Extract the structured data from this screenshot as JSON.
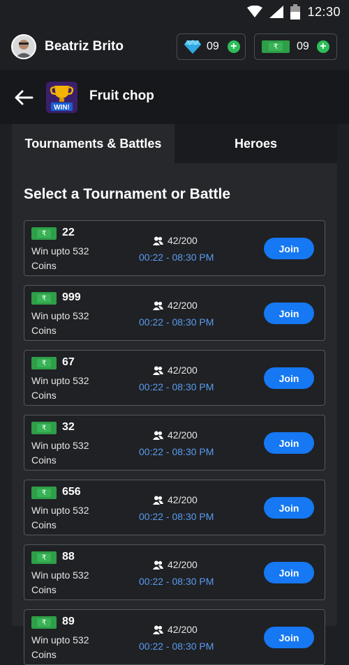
{
  "status_bar": {
    "time": "12:30"
  },
  "header": {
    "username": "Beatriz Brito",
    "gems": {
      "value": "09",
      "icon": "diamond-icon"
    },
    "cash": {
      "value": "09",
      "icon": "rupee-note-icon"
    }
  },
  "game": {
    "title": "Fruit chop",
    "icon_text": "WIN!"
  },
  "tabs": [
    {
      "label": "Tournaments & Battles",
      "active": true
    },
    {
      "label": "Heroes",
      "active": false
    }
  ],
  "section_title": "Select a Tournament or Battle",
  "currency_symbol": "₹",
  "cards": [
    {
      "fee": "22",
      "prize_line1": "Win upto 532",
      "prize_line2": "Coins",
      "players": "42/200",
      "time": "00:22 - 08:30 PM",
      "button": "Join"
    },
    {
      "fee": "999",
      "prize_line1": "Win upto 532",
      "prize_line2": "Coins",
      "players": "42/200",
      "time": "00:22 - 08:30 PM",
      "button": "Join"
    },
    {
      "fee": "67",
      "prize_line1": "Win upto 532",
      "prize_line2": "Coins",
      "players": "42/200",
      "time": "00:22 - 08:30 PM",
      "button": "Join"
    },
    {
      "fee": "32",
      "prize_line1": "Win upto 532",
      "prize_line2": "Coins",
      "players": "42/200",
      "time": "00:22 - 08:30 PM",
      "button": "Join"
    },
    {
      "fee": "656",
      "prize_line1": "Win upto 532",
      "prize_line2": "Coins",
      "players": "42/200",
      "time": "00:22 - 08:30 PM",
      "button": "Join"
    },
    {
      "fee": "88",
      "prize_line1": "Win upto 532",
      "prize_line2": "Coins",
      "players": "42/200",
      "time": "00:22 - 08:30 PM",
      "button": "Join"
    },
    {
      "fee": "89",
      "prize_line1": "Win upto 532",
      "prize_line2": "Coins",
      "players": "42/200",
      "time": "00:22 - 08:30 PM",
      "button": "Join"
    }
  ],
  "colors": {
    "background": "#1d1f23",
    "accent_blue": "#1678f2",
    "time_text": "#5b9bf0",
    "plus_green": "#2ebd59",
    "note_green": "#2e9e48"
  }
}
